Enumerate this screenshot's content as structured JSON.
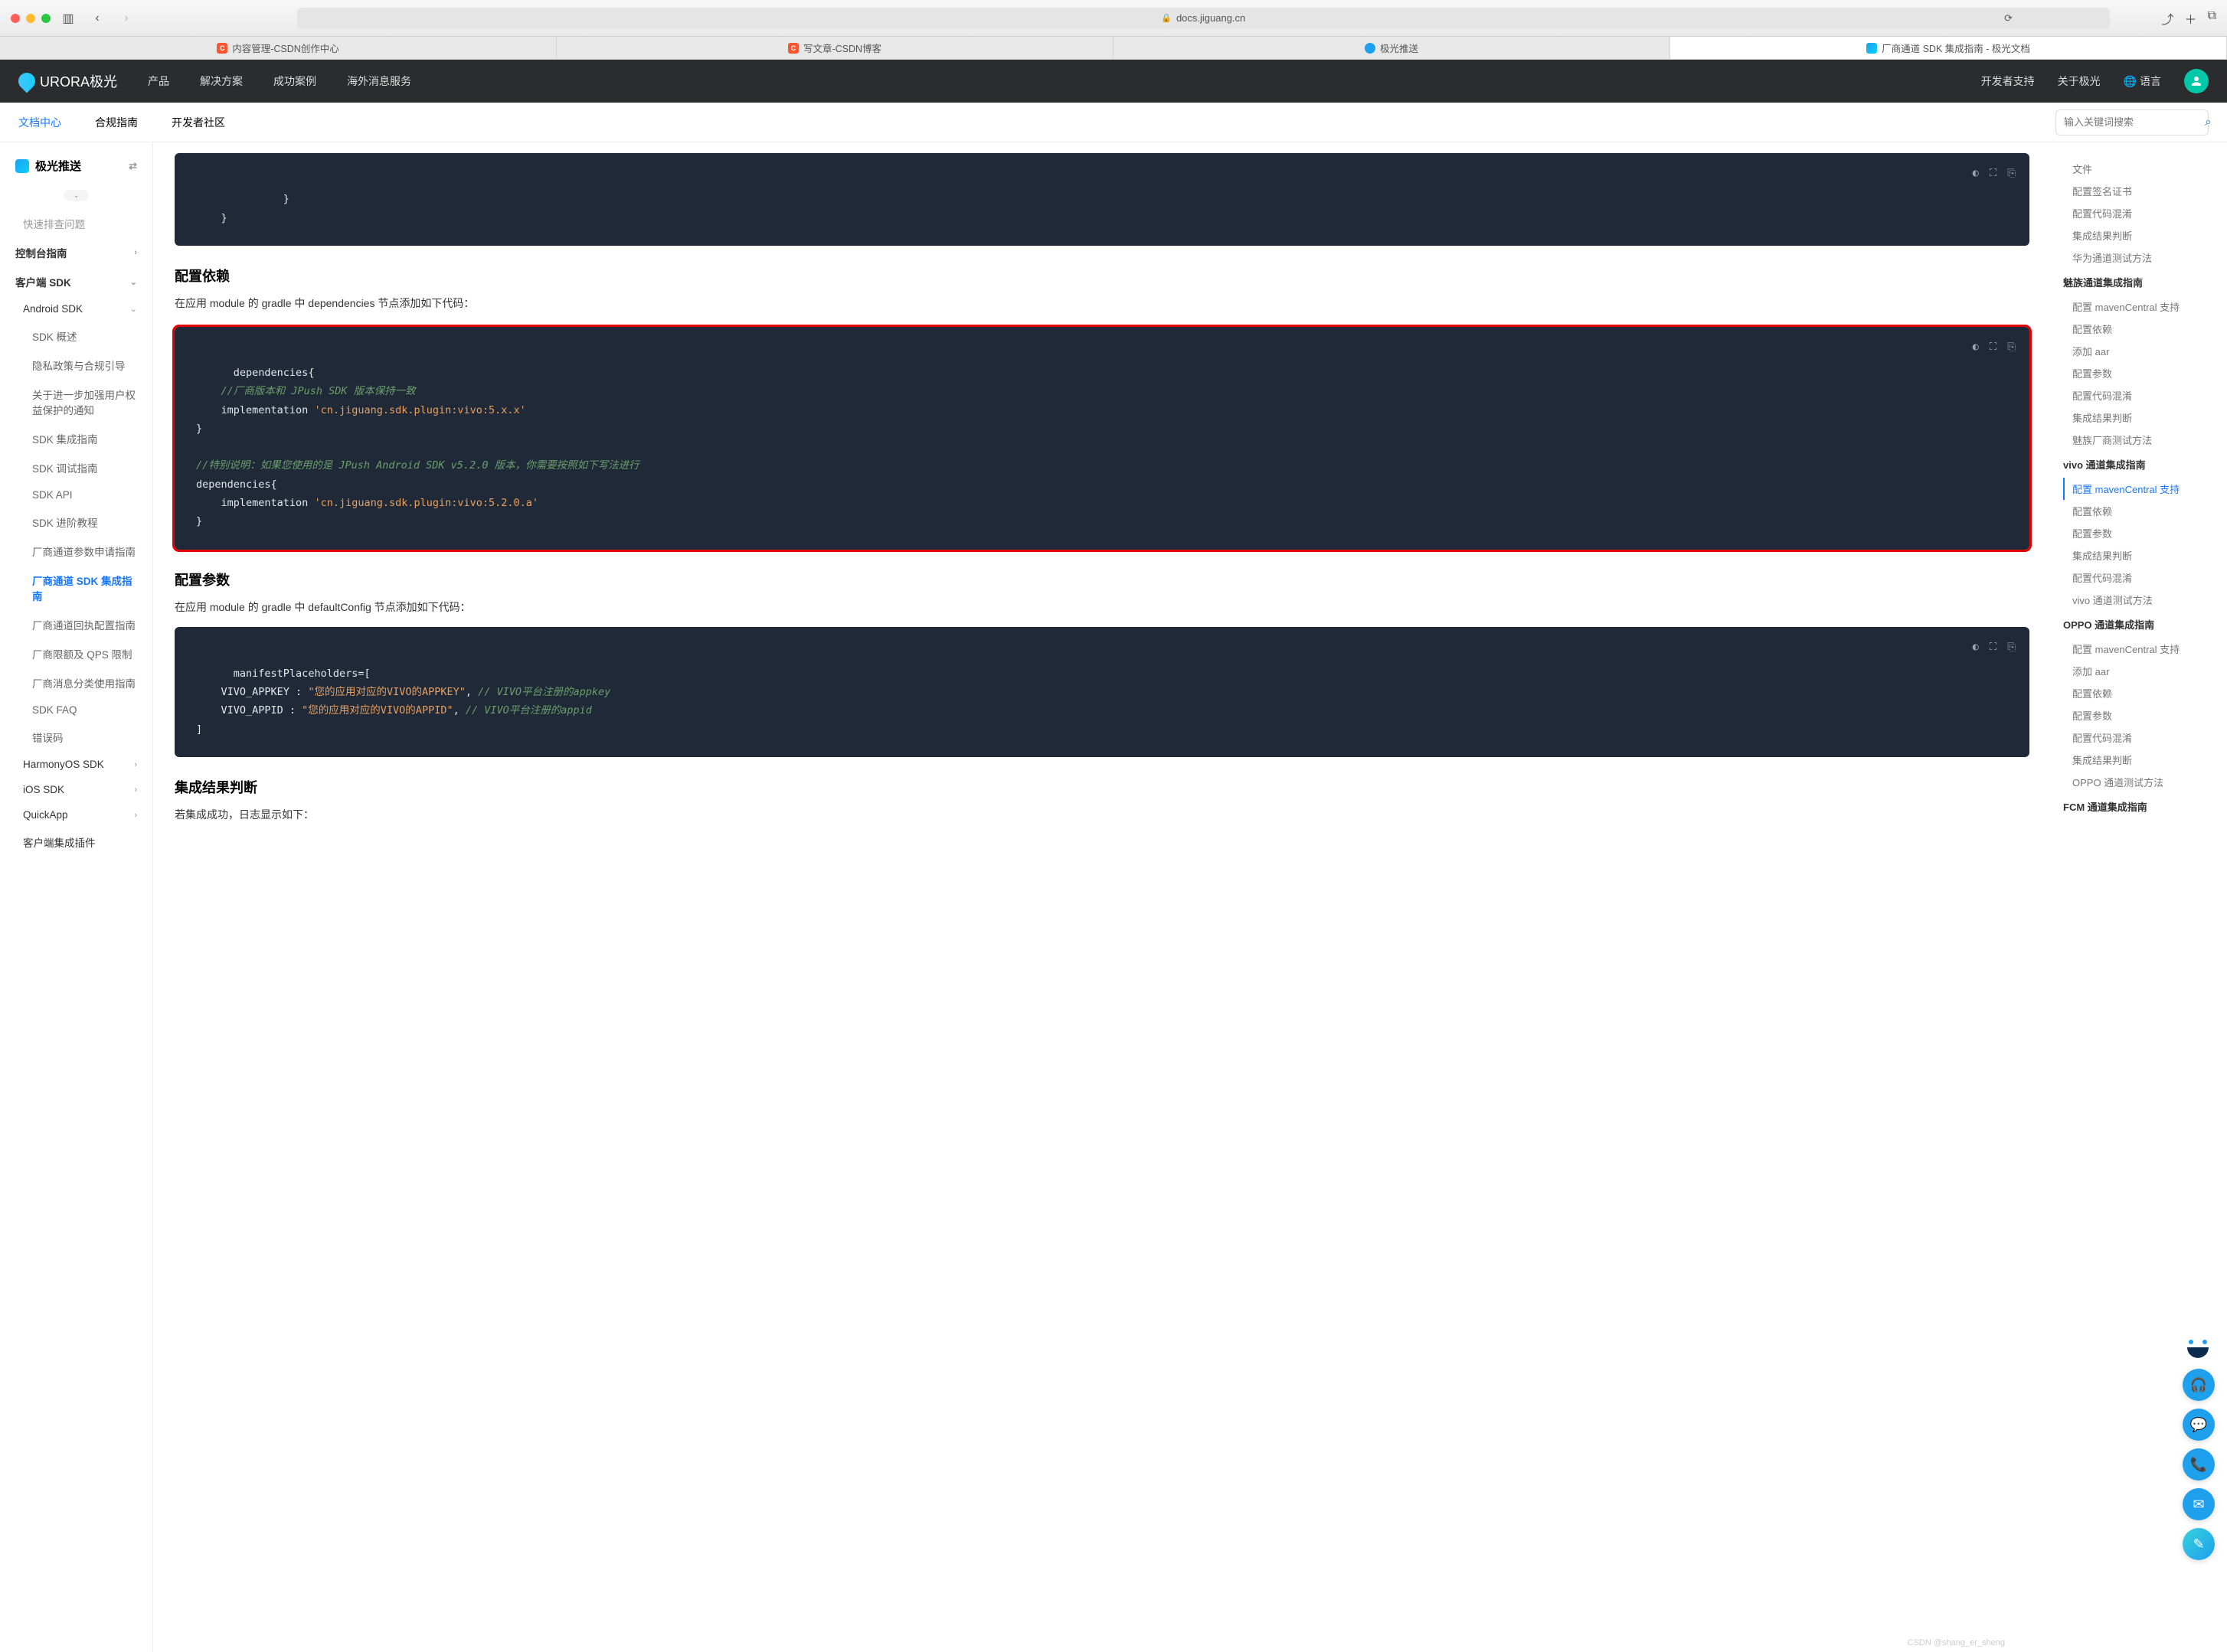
{
  "browser": {
    "url_host": "docs.jiguang.cn",
    "tabs": [
      {
        "label": "内容管理-CSDN创作中心"
      },
      {
        "label": "写文章-CSDN博客"
      },
      {
        "label": "极光推送"
      },
      {
        "label": "厂商通道 SDK 集成指南 - 极光文档"
      }
    ]
  },
  "header": {
    "logo_text": "URORA极光",
    "nav": [
      "产品",
      "解决方案",
      "成功案例",
      "海外消息服务"
    ],
    "right": [
      "开发者支持",
      "关于极光",
      "语言"
    ],
    "lang_icon": "🌐"
  },
  "subheader": {
    "nav": [
      "文档中心",
      "合规指南",
      "开发者社区"
    ],
    "search_placeholder": "输入关键词搜索"
  },
  "sidebar": {
    "title": "极光推送",
    "quick_label": "快速排查问题",
    "items": [
      {
        "label": "控制台指南",
        "level": 1,
        "chev": "›"
      },
      {
        "label": "客户端 SDK",
        "level": 1,
        "chev": "⌄"
      },
      {
        "label": "Android SDK",
        "level": 2,
        "chev": "⌄"
      },
      {
        "label": "SDK 概述",
        "level": 3
      },
      {
        "label": "隐私政策与合规引导",
        "level": 3
      },
      {
        "label": "关于进一步加强用户权益保护的通知",
        "level": 3
      },
      {
        "label": "SDK 集成指南",
        "level": 3
      },
      {
        "label": "SDK 调试指南",
        "level": 3
      },
      {
        "label": "SDK API",
        "level": 3
      },
      {
        "label": "SDK 进阶教程",
        "level": 3
      },
      {
        "label": "厂商通道参数申请指南",
        "level": 3
      },
      {
        "label": "厂商通道 SDK 集成指南",
        "level": 3,
        "active": true
      },
      {
        "label": "厂商通道回执配置指南",
        "level": 3
      },
      {
        "label": "厂商限额及 QPS 限制",
        "level": 3
      },
      {
        "label": "厂商消息分类使用指南",
        "level": 3
      },
      {
        "label": "SDK FAQ",
        "level": 3
      },
      {
        "label": "错误码",
        "level": 3
      },
      {
        "label": "HarmonyOS SDK",
        "level": 2,
        "chev": "›"
      },
      {
        "label": "iOS SDK",
        "level": 2,
        "chev": "›"
      },
      {
        "label": "QuickApp",
        "level": 2,
        "chev": "›"
      },
      {
        "label": "客户端集成插件",
        "level": 2
      }
    ]
  },
  "content": {
    "code_top_brace": "        }\n    }",
    "h_deps": "配置依赖",
    "p_deps": "在应用 module 的 gradle 中 dependencies 节点添加如下代码：",
    "code_deps_l1": "dependencies{",
    "code_deps_l2": "    //厂商版本和 JPush SDK 版本保持一致",
    "code_deps_l3": "    implementation ",
    "code_deps_l3s": "'cn.jiguang.sdk.plugin:vivo:5.x.x'",
    "code_deps_l4": "}",
    "code_deps_l5": "",
    "code_deps_l6": "//特别说明：如果您使用的是 JPush Android SDK v5.2.0 版本，你需要按照如下写法进行",
    "code_deps_l7": "dependencies{",
    "code_deps_l8": "    implementation ",
    "code_deps_l8s": "'cn.jiguang.sdk.plugin:vivo:5.2.0.a'",
    "code_deps_l9": "}",
    "h_params": "配置参数",
    "p_params": "在应用 module 的 gradle 中 defaultConfig 节点添加如下代码：",
    "code_params_l1": "manifestPlaceholders=[",
    "code_params_l2": "    VIVO_APPKEY : ",
    "code_params_l2s": "\"您的应用对应的VIVO的APPKEY\"",
    "code_params_l2c": ", ",
    "code_params_l2cm": "// VIVO平台注册的appkey",
    "code_params_l3": "    VIVO_APPID : ",
    "code_params_l3s": "\"您的应用对应的VIVO的APPID\"",
    "code_params_l3c": ", ",
    "code_params_l3cm": "// VIVO平台注册的appid",
    "code_params_l4": "]",
    "h_result": "集成结果判断",
    "p_result": "若集成成功，日志显示如下："
  },
  "toc": {
    "groups": [
      {
        "items": [
          "文件",
          "配置签名证书",
          "配置代码混淆",
          "集成结果判断",
          "华为通道测试方法"
        ]
      },
      {
        "title": "魅族通道集成指南",
        "items": [
          "配置 mavenCentral 支持",
          "配置依赖",
          "添加 aar",
          "配置参数",
          "配置代码混淆",
          "集成结果判断",
          "魅族厂商测试方法"
        ]
      },
      {
        "title": "vivo 通道集成指南",
        "items": [
          {
            "label": "配置 mavenCentral 支持",
            "active": true
          },
          "配置依赖",
          "配置参数",
          "集成结果判断",
          "配置代码混淆",
          "vivo 通道测试方法"
        ]
      },
      {
        "title": "OPPO 通道集成指南",
        "items": [
          "配置 mavenCentral 支持",
          "添加 aar",
          "配置依赖",
          "配置参数",
          "配置代码混淆",
          "集成结果判断",
          "OPPO 通道测试方法"
        ]
      },
      {
        "title": "FCM 通道集成指南",
        "items": []
      }
    ]
  },
  "watermark": "CSDN @shang_er_sheng"
}
